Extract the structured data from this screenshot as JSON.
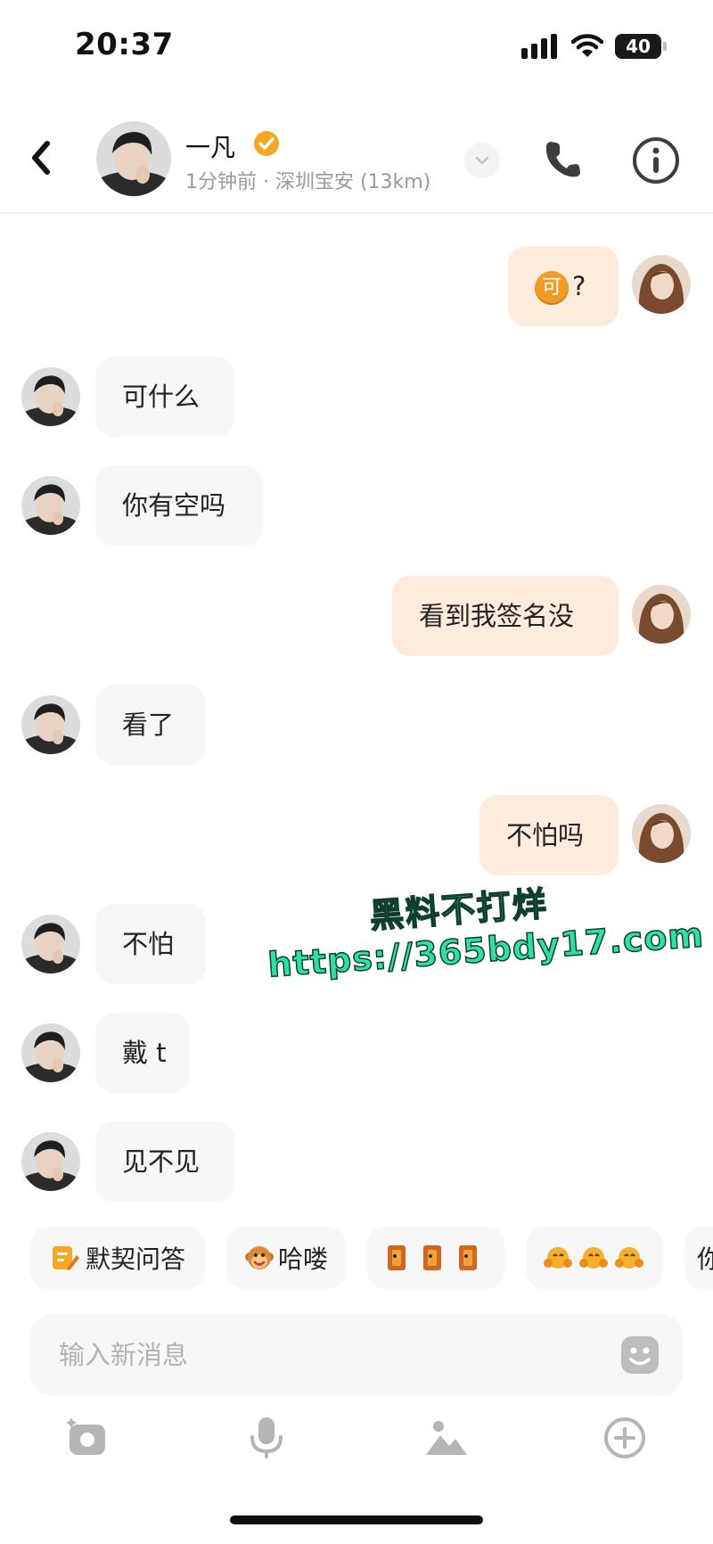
{
  "status_bar": {
    "time": "20:37",
    "battery": "40"
  },
  "header": {
    "name": "一凡",
    "status_text": "1分钟前 · 深圳宝安 (13km)"
  },
  "messages": [
    {
      "side": "out",
      "text": "?",
      "emoji": "可"
    },
    {
      "side": "in",
      "text": "可什么"
    },
    {
      "side": "in",
      "text": "你有空吗"
    },
    {
      "side": "out",
      "text": "看到我签名没"
    },
    {
      "side": "in",
      "text": "看了"
    },
    {
      "side": "out",
      "text": "不怕吗"
    },
    {
      "side": "in",
      "text": "不怕"
    },
    {
      "side": "in",
      "text": "戴 t"
    },
    {
      "side": "in",
      "text": "见不见"
    }
  ],
  "quick_replies": [
    {
      "label": "默契问答",
      "icon": "pencil-note-icon"
    },
    {
      "label": "哈喽",
      "icon": "monkey-emoji-icon"
    },
    {
      "label": "",
      "icon": "door-emoji-icon"
    },
    {
      "label": "",
      "icon": "hug-emoji-icon"
    },
    {
      "label": "你",
      "icon": ""
    }
  ],
  "input": {
    "placeholder": "输入新消息"
  },
  "watermark": {
    "line1": "黑料不打烊",
    "line2": "https://365bdy17.com"
  },
  "colors": {
    "accent": "#f5a623",
    "outgoing_bubble": "#fdebdc",
    "incoming_bubble": "#f7f7f7",
    "watermark": "#2fe0a6"
  }
}
